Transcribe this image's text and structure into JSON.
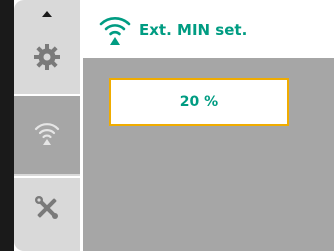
{
  "header": {
    "title": "Ext. MIN set.",
    "icon": "external-signal-icon"
  },
  "sidebar": {
    "items": [
      {
        "icon": "gear-icon",
        "selected": false
      },
      {
        "icon": "external-signal-icon",
        "selected": true
      },
      {
        "icon": "tools-icon",
        "selected": false
      }
    ],
    "scroll_indicator": "up-arrow-icon"
  },
  "main": {
    "value": "20 %"
  },
  "colors": {
    "accent_green": "#009c82",
    "focus_border": "#f0ac00",
    "panel_gray": "#a6a6a6",
    "sidebar_gray": "#d9d9d9"
  }
}
